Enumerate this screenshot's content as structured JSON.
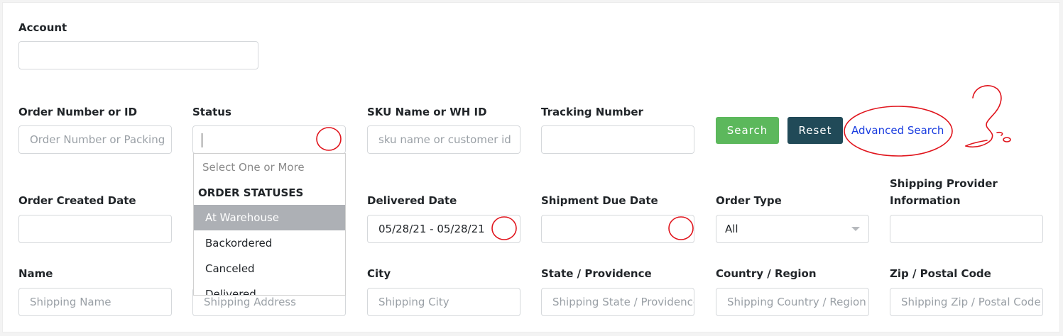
{
  "account": {
    "label": "Account",
    "value": ""
  },
  "order_number": {
    "label": "Order Number or ID",
    "placeholder": "Order Number or Packing"
  },
  "status": {
    "label": "Status",
    "value": ""
  },
  "sku": {
    "label": "SKU Name or WH ID",
    "placeholder": "sku name or customer id"
  },
  "tracking": {
    "label": "Tracking Number",
    "value": ""
  },
  "buttons": {
    "search": "Search",
    "reset": "Reset",
    "advanced": "Advanced Search"
  },
  "status_dropdown": {
    "placeholder": "Select One or More",
    "group_label": "ORDER STATUSES",
    "options": [
      "At Warehouse",
      "Backordered",
      "Canceled",
      "Delivered"
    ],
    "highlighted": "At Warehouse"
  },
  "order_created_date": {
    "label": "Order Created Date",
    "value": ""
  },
  "delivered_date": {
    "label": "Delivered Date",
    "value": "05/28/21 - 05/28/21"
  },
  "shipment_due_date": {
    "label": "Shipment Due Date",
    "value": ""
  },
  "order_type": {
    "label": "Order Type",
    "value": "All"
  },
  "shipping_provider": {
    "label": "Shipping Provider Information",
    "value": ""
  },
  "name": {
    "label": "Name",
    "placeholder": "Shipping Name"
  },
  "address": {
    "placeholder": "Shipping Address"
  },
  "city": {
    "label": "City",
    "placeholder": "Shipping City"
  },
  "state": {
    "label": "State / Providence",
    "placeholder": "Shipping State / Providence"
  },
  "country": {
    "label": "Country / Region",
    "placeholder": "Shipping Country / Region"
  },
  "zip": {
    "label": "Zip / Postal Code",
    "placeholder": "Shipping Zip / Postal Code"
  },
  "annotation_color": "#e0141c"
}
